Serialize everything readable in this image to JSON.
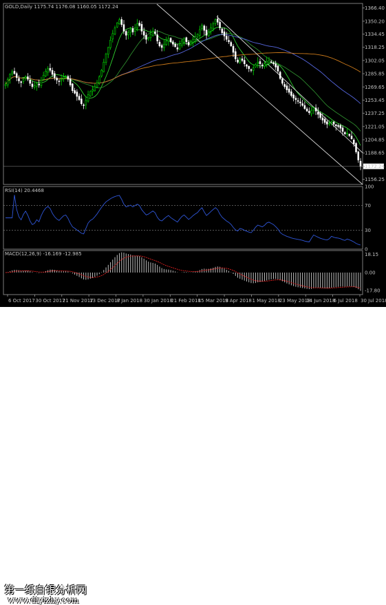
{
  "chart_data": [
    {
      "type": "candlestick",
      "title": "GOLD,Daily  1175.74 1176.08 1160.05 1172.24",
      "ylim": [
        1150,
        1372
      ],
      "y_ticks": [
        "1366.40",
        "1350.20",
        "1334.45",
        "1318.25",
        "1302.05",
        "1285.85",
        "1269.65",
        "1253.45",
        "1237.25",
        "1221.05",
        "1204.85",
        "1188.65",
        "1172.24",
        "1156.25"
      ],
      "last_price": "1172.24",
      "x_ticks": [
        "6 Oct 2017",
        "30 Oct 2017",
        "21 Nov 2017",
        "13 Dec 2017",
        "8 Jan 2018",
        "30 Jan 2018",
        "21 Feb 2018",
        "15 Mar 2018",
        "9 Apr 2018",
        "1 May 2018",
        "23 May 2018",
        "14 Jun 2018",
        "6 Jul 2018",
        "30 Jul 2018"
      ],
      "close": [
        1273,
        1279,
        1285,
        1288,
        1286,
        1281,
        1277,
        1275,
        1279,
        1282,
        1279,
        1274,
        1270,
        1271,
        1274,
        1272,
        1278,
        1284,
        1289,
        1292,
        1290,
        1285,
        1281,
        1278,
        1276,
        1279,
        1282,
        1283,
        1279,
        1272,
        1265,
        1262,
        1258,
        1254,
        1249,
        1247,
        1253,
        1260,
        1264,
        1266,
        1270,
        1275,
        1282,
        1290,
        1300,
        1310,
        1318,
        1327,
        1335,
        1342,
        1348,
        1352,
        1346,
        1338,
        1333,
        1336,
        1340,
        1337,
        1342,
        1347,
        1345,
        1338,
        1333,
        1328,
        1330,
        1334,
        1338,
        1335,
        1326,
        1320,
        1318,
        1322,
        1326,
        1329,
        1325,
        1322,
        1319,
        1316,
        1321,
        1326,
        1329,
        1325,
        1321,
        1324,
        1328,
        1331,
        1334,
        1340,
        1345,
        1339,
        1333,
        1337,
        1342,
        1347,
        1352,
        1349,
        1342,
        1336,
        1332,
        1328,
        1325,
        1320,
        1312,
        1304,
        1300,
        1304,
        1302,
        1298,
        1295,
        1292,
        1290,
        1293,
        1297,
        1300,
        1298,
        1296,
        1298,
        1301,
        1302,
        1300,
        1298,
        1294,
        1289,
        1280,
        1274,
        1270,
        1266,
        1263,
        1259,
        1256,
        1254,
        1252,
        1250,
        1247,
        1243,
        1240,
        1238,
        1241,
        1244,
        1240,
        1236,
        1232,
        1229,
        1226,
        1224,
        1225,
        1227,
        1224,
        1222,
        1221,
        1219,
        1215,
        1212,
        1213,
        1210,
        1206,
        1200,
        1190,
        1180,
        1172
      ],
      "rsi_title": "RSI(14) 20.4468",
      "rsi_levels": [
        "100",
        "70",
        "30",
        "0"
      ],
      "macd_title": "MACD(12,26,9) -16.169 -12.985",
      "macd_levels": [
        "18.15",
        "0.00",
        "-17.80"
      ]
    }
  ],
  "watermark": {
    "line1": "第一纸白银分析网",
    "line2": "www.diyizby.com"
  }
}
